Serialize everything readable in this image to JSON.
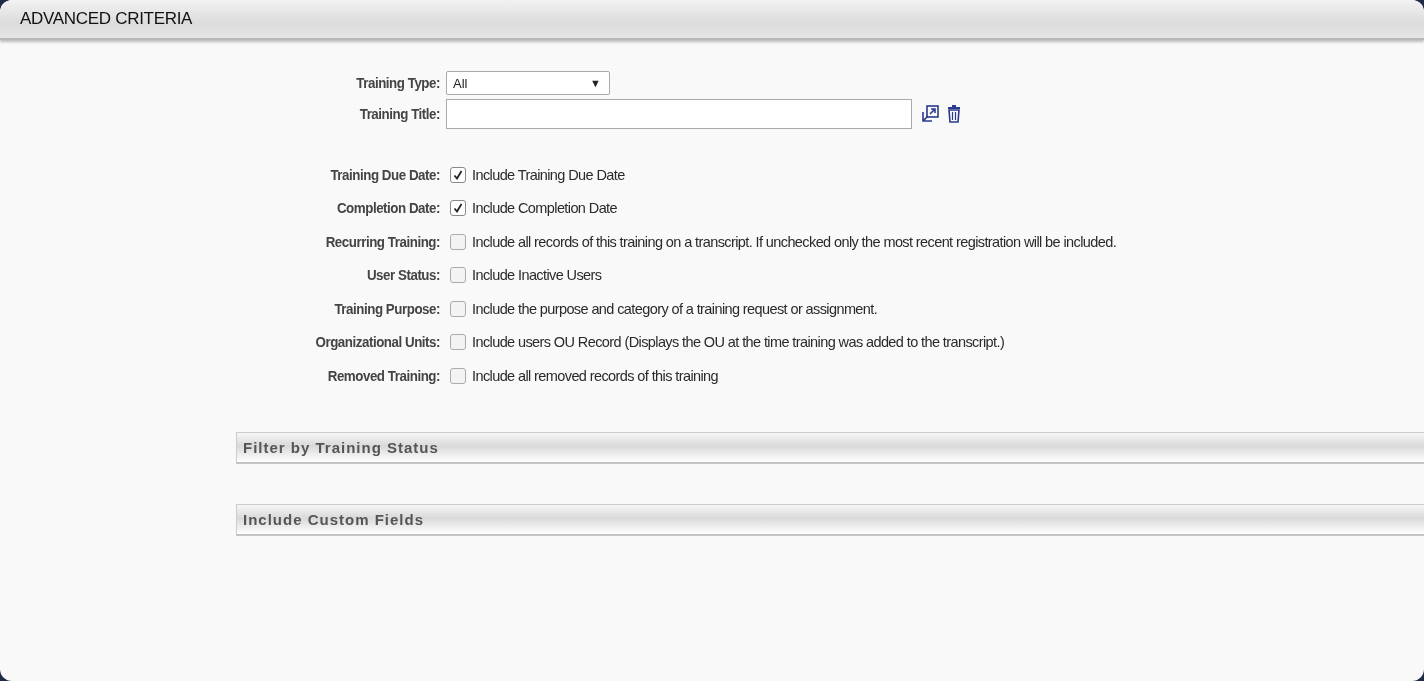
{
  "header": {
    "title": "ADVANCED CRITERIA"
  },
  "training_type": {
    "label": "Training Type:",
    "value": "All",
    "caret": "▼"
  },
  "training_title": {
    "label": "Training Title:"
  },
  "options": [
    {
      "label": "Training Due Date:",
      "text": "Include Training Due Date",
      "checked": true
    },
    {
      "label": "Completion Date:",
      "text": "Include Completion Date",
      "checked": true
    },
    {
      "label": "Recurring Training:",
      "text": "Include all records of this training on a transcript. If unchecked only the most recent registration will be included.",
      "checked": false
    },
    {
      "label": "User Status:",
      "text": "Include Inactive Users",
      "checked": false
    },
    {
      "label": "Training Purpose:",
      "text": "Include the purpose and category of a training request or assignment.",
      "checked": false
    },
    {
      "label": "Organizational Units:",
      "text": "Include users OU Record (Displays the OU at the time training was added to the transcript.)",
      "checked": false
    },
    {
      "label": "Removed Training:",
      "text": "Include all removed records of this training",
      "checked": false
    }
  ],
  "sections": [
    {
      "title": "Filter by Training Status"
    },
    {
      "title": "Include Custom Fields"
    }
  ]
}
